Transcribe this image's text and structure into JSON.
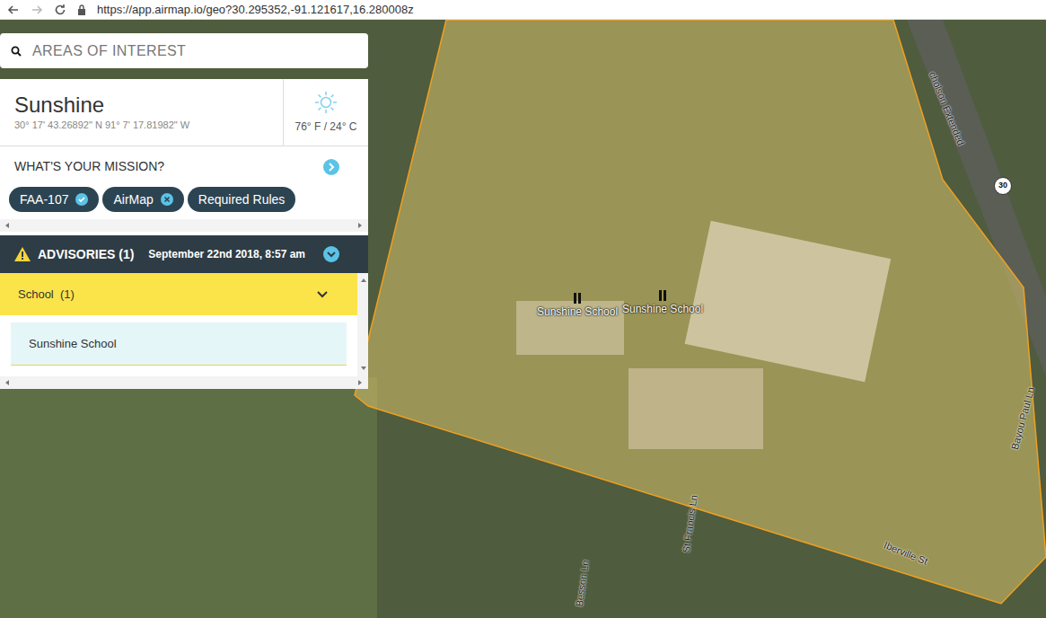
{
  "browser": {
    "url": "https://app.airmap.io/geo?30.295352,-91.121617,16.280008z"
  },
  "search": {
    "placeholder": "AREAS OF INTEREST"
  },
  "location": {
    "name": "Sunshine",
    "coordinates": "30° 17' 43.26892\" N 91° 7' 17.81982\" W",
    "weather": "76° F / 24° C"
  },
  "mission": {
    "title": "WHAT'S YOUR MISSION?",
    "chips": [
      {
        "label": "FAA-107",
        "kind": "check"
      },
      {
        "label": "AirMap",
        "kind": "close"
      },
      {
        "label": "Required Rules",
        "kind": "plain"
      }
    ]
  },
  "advisories": {
    "title": "ADVISORIES (1)",
    "date": "September 22nd 2018, 8:57 am",
    "expanded": true,
    "categories": [
      {
        "label": "School",
        "count": "(1)",
        "expanded": true,
        "items": [
          "Sunshine School"
        ]
      }
    ]
  },
  "map": {
    "labels": [
      {
        "text": "Sunshine School",
        "kind": "pin"
      },
      {
        "text": "Sunshine School",
        "kind": "pin"
      },
      {
        "text": "Iberville St",
        "kind": "street"
      },
      {
        "text": "St Francis Ln",
        "kind": "street"
      },
      {
        "text": "Besson Ln",
        "kind": "street"
      },
      {
        "text": "Bayou Paul Ln",
        "kind": "street"
      },
      {
        "text": "cholson Extended",
        "kind": "street"
      },
      {
        "text": "30",
        "kind": "shield"
      }
    ]
  }
}
